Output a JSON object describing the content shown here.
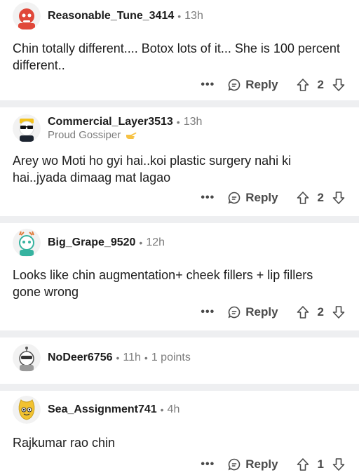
{
  "comments": [
    {
      "username": "Reasonable_Tune_3414",
      "time": "13h",
      "body": "Chin totally different.... Botox lots of it... She is 100 percent different..",
      "reply_label": "Reply",
      "vote_count": "2",
      "avatar_color": "#e0483a"
    },
    {
      "username": "Commercial_Layer3513",
      "time": "13h",
      "flair": "Proud Gossiper",
      "body": "Arey wo Moti ho gyi hai..koi plastic surgery nahi ki hai..jyada dimaag mat lagao",
      "reply_label": "Reply",
      "vote_count": "2",
      "avatar_color": "#f3c21c"
    },
    {
      "username": "Big_Grape_9520",
      "time": "12h",
      "body": "Looks like chin augmentation+ cheek fillers + lip fillers gone wrong",
      "reply_label": "Reply",
      "vote_count": "2",
      "avatar_color": "#36b3a0"
    },
    {
      "username": "NoDeer6756",
      "time": "11h",
      "points": "1 points",
      "avatar_color": "#9a9a9a"
    },
    {
      "username": "Sea_Assignment741",
      "time": "4h",
      "body": "Rajkumar rao chin",
      "reply_label": "Reply",
      "vote_count": "1",
      "avatar_color": "#f2c230"
    }
  ],
  "more_label": "•••"
}
